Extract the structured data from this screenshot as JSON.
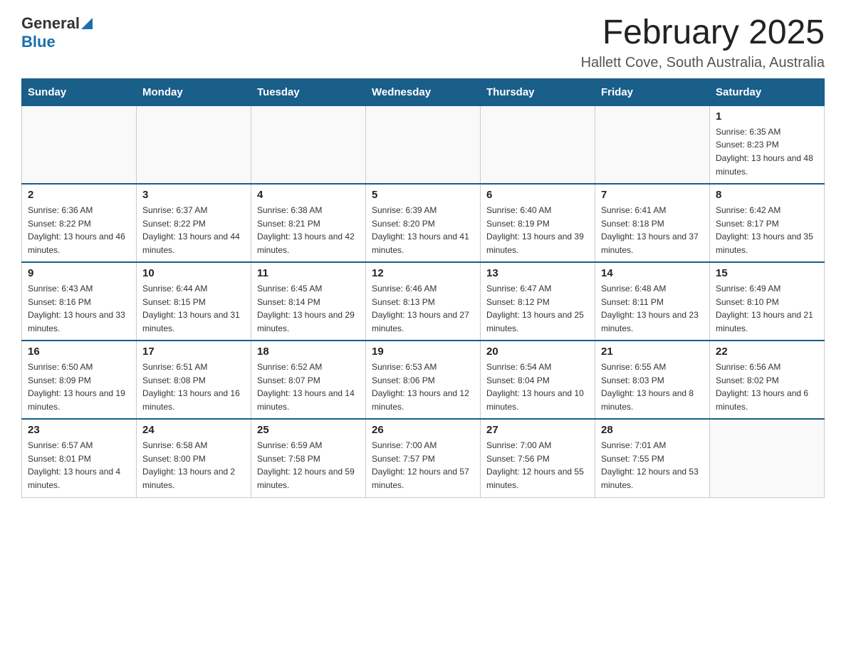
{
  "header": {
    "logo_general": "General",
    "logo_blue": "Blue",
    "title": "February 2025",
    "location": "Hallett Cove, South Australia, Australia"
  },
  "days_of_week": [
    "Sunday",
    "Monday",
    "Tuesday",
    "Wednesday",
    "Thursday",
    "Friday",
    "Saturday"
  ],
  "weeks": [
    [
      {
        "day": "",
        "info": ""
      },
      {
        "day": "",
        "info": ""
      },
      {
        "day": "",
        "info": ""
      },
      {
        "day": "",
        "info": ""
      },
      {
        "day": "",
        "info": ""
      },
      {
        "day": "",
        "info": ""
      },
      {
        "day": "1",
        "info": "Sunrise: 6:35 AM\nSunset: 8:23 PM\nDaylight: 13 hours and 48 minutes."
      }
    ],
    [
      {
        "day": "2",
        "info": "Sunrise: 6:36 AM\nSunset: 8:22 PM\nDaylight: 13 hours and 46 minutes."
      },
      {
        "day": "3",
        "info": "Sunrise: 6:37 AM\nSunset: 8:22 PM\nDaylight: 13 hours and 44 minutes."
      },
      {
        "day": "4",
        "info": "Sunrise: 6:38 AM\nSunset: 8:21 PM\nDaylight: 13 hours and 42 minutes."
      },
      {
        "day": "5",
        "info": "Sunrise: 6:39 AM\nSunset: 8:20 PM\nDaylight: 13 hours and 41 minutes."
      },
      {
        "day": "6",
        "info": "Sunrise: 6:40 AM\nSunset: 8:19 PM\nDaylight: 13 hours and 39 minutes."
      },
      {
        "day": "7",
        "info": "Sunrise: 6:41 AM\nSunset: 8:18 PM\nDaylight: 13 hours and 37 minutes."
      },
      {
        "day": "8",
        "info": "Sunrise: 6:42 AM\nSunset: 8:17 PM\nDaylight: 13 hours and 35 minutes."
      }
    ],
    [
      {
        "day": "9",
        "info": "Sunrise: 6:43 AM\nSunset: 8:16 PM\nDaylight: 13 hours and 33 minutes."
      },
      {
        "day": "10",
        "info": "Sunrise: 6:44 AM\nSunset: 8:15 PM\nDaylight: 13 hours and 31 minutes."
      },
      {
        "day": "11",
        "info": "Sunrise: 6:45 AM\nSunset: 8:14 PM\nDaylight: 13 hours and 29 minutes."
      },
      {
        "day": "12",
        "info": "Sunrise: 6:46 AM\nSunset: 8:13 PM\nDaylight: 13 hours and 27 minutes."
      },
      {
        "day": "13",
        "info": "Sunrise: 6:47 AM\nSunset: 8:12 PM\nDaylight: 13 hours and 25 minutes."
      },
      {
        "day": "14",
        "info": "Sunrise: 6:48 AM\nSunset: 8:11 PM\nDaylight: 13 hours and 23 minutes."
      },
      {
        "day": "15",
        "info": "Sunrise: 6:49 AM\nSunset: 8:10 PM\nDaylight: 13 hours and 21 minutes."
      }
    ],
    [
      {
        "day": "16",
        "info": "Sunrise: 6:50 AM\nSunset: 8:09 PM\nDaylight: 13 hours and 19 minutes."
      },
      {
        "day": "17",
        "info": "Sunrise: 6:51 AM\nSunset: 8:08 PM\nDaylight: 13 hours and 16 minutes."
      },
      {
        "day": "18",
        "info": "Sunrise: 6:52 AM\nSunset: 8:07 PM\nDaylight: 13 hours and 14 minutes."
      },
      {
        "day": "19",
        "info": "Sunrise: 6:53 AM\nSunset: 8:06 PM\nDaylight: 13 hours and 12 minutes."
      },
      {
        "day": "20",
        "info": "Sunrise: 6:54 AM\nSunset: 8:04 PM\nDaylight: 13 hours and 10 minutes."
      },
      {
        "day": "21",
        "info": "Sunrise: 6:55 AM\nSunset: 8:03 PM\nDaylight: 13 hours and 8 minutes."
      },
      {
        "day": "22",
        "info": "Sunrise: 6:56 AM\nSunset: 8:02 PM\nDaylight: 13 hours and 6 minutes."
      }
    ],
    [
      {
        "day": "23",
        "info": "Sunrise: 6:57 AM\nSunset: 8:01 PM\nDaylight: 13 hours and 4 minutes."
      },
      {
        "day": "24",
        "info": "Sunrise: 6:58 AM\nSunset: 8:00 PM\nDaylight: 13 hours and 2 minutes."
      },
      {
        "day": "25",
        "info": "Sunrise: 6:59 AM\nSunset: 7:58 PM\nDaylight: 12 hours and 59 minutes."
      },
      {
        "day": "26",
        "info": "Sunrise: 7:00 AM\nSunset: 7:57 PM\nDaylight: 12 hours and 57 minutes."
      },
      {
        "day": "27",
        "info": "Sunrise: 7:00 AM\nSunset: 7:56 PM\nDaylight: 12 hours and 55 minutes."
      },
      {
        "day": "28",
        "info": "Sunrise: 7:01 AM\nSunset: 7:55 PM\nDaylight: 12 hours and 53 minutes."
      },
      {
        "day": "",
        "info": ""
      }
    ]
  ]
}
